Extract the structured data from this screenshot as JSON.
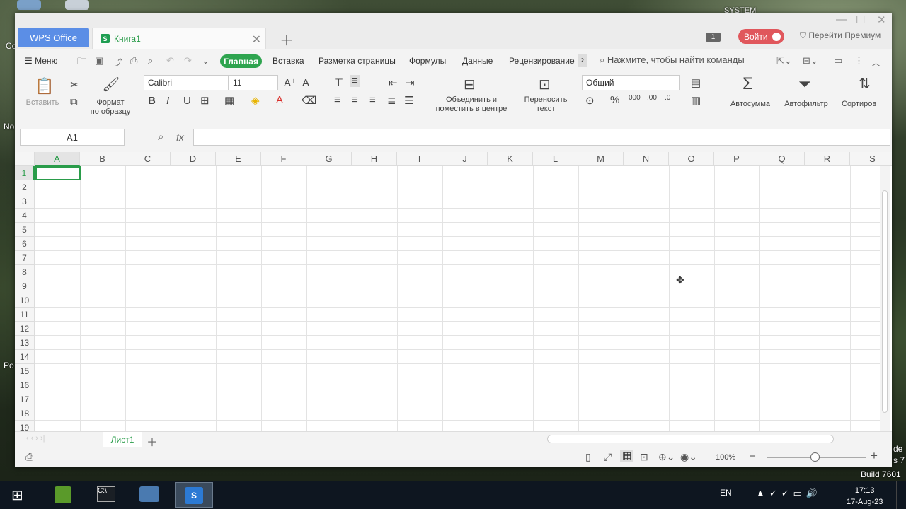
{
  "desktop": {
    "top_text": "SYSTEM",
    "left_labels": [
      "Co",
      "No",
      "Po"
    ],
    "right_labels": [
      "de",
      "s 7"
    ],
    "build": "Build 7601"
  },
  "window": {
    "app_tab": "WPS Office",
    "doc_tab": "Книга1",
    "badge": "1",
    "login": "Войти",
    "premium": "Перейти Премиум"
  },
  "menu": {
    "menu_label": "Меню",
    "tabs": [
      "Главная",
      "Вставка",
      "Разметка страницы",
      "Формулы",
      "Данные",
      "Рецензирование"
    ],
    "search_placeholder": "Нажмите, чтобы найти команды"
  },
  "ribbon": {
    "paste": "Вставить",
    "format_painter": [
      "Формат",
      "по образцу"
    ],
    "font": "Calibri",
    "size": "11",
    "merge": [
      "Объединить и",
      "поместить в центре"
    ],
    "wrap": [
      "Переносить",
      "текст"
    ],
    "number_format": "Общий",
    "autosum": "Автосумма",
    "autofilter": "Автофильтр",
    "sort": "Сортиров"
  },
  "formula_bar": {
    "name_box": "A1",
    "fx": "fx",
    "value": ""
  },
  "sheet": {
    "columns": [
      "A",
      "B",
      "C",
      "D",
      "E",
      "F",
      "G",
      "H",
      "I",
      "J",
      "K",
      "L",
      "M",
      "N",
      "O",
      "P",
      "Q",
      "R",
      "S"
    ],
    "rows": [
      "1",
      "2",
      "3",
      "4",
      "5",
      "6",
      "7",
      "8",
      "9",
      "10",
      "11",
      "12",
      "13",
      "14",
      "15",
      "16",
      "17",
      "18",
      "19"
    ],
    "active_cell": "A1",
    "tabs": [
      "Лист1"
    ]
  },
  "status": {
    "zoom": "100%"
  },
  "taskbar": {
    "lang": "EN",
    "time": "17:13",
    "date": "17-Aug-23"
  }
}
